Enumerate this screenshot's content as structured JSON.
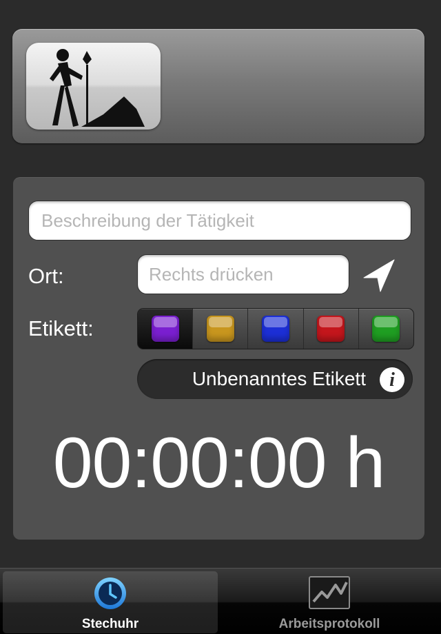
{
  "header": {
    "activity_icon": "hiker-with-shovel-icon"
  },
  "form": {
    "description_placeholder": "Beschreibung der Tätigkeit",
    "location_label": "Ort:",
    "location_placeholder": "Rechts drücken",
    "location_button_icon": "location-arrow-icon",
    "tag_label": "Etikett:",
    "tag_colors": [
      {
        "name": "purple",
        "color": "#7a1fd0",
        "selected": true
      },
      {
        "name": "gold",
        "color": "#c8961e",
        "selected": false
      },
      {
        "name": "blue",
        "color": "#1c2fd6",
        "selected": false
      },
      {
        "name": "red",
        "color": "#c4161c",
        "selected": false
      },
      {
        "name": "green",
        "color": "#1f9e22",
        "selected": false
      }
    ],
    "tag_name": "Unbenanntes Etikett",
    "tag_info_icon": "info-icon",
    "tag_info_glyph": "i"
  },
  "timer": {
    "value": "00:00:00 h"
  },
  "tab_bar": {
    "tabs": [
      {
        "label": "Stechuhr",
        "icon": "clock-icon",
        "active": true
      },
      {
        "label": "Arbeitsprotokoll",
        "icon": "chart-line-icon",
        "active": false
      }
    ]
  }
}
